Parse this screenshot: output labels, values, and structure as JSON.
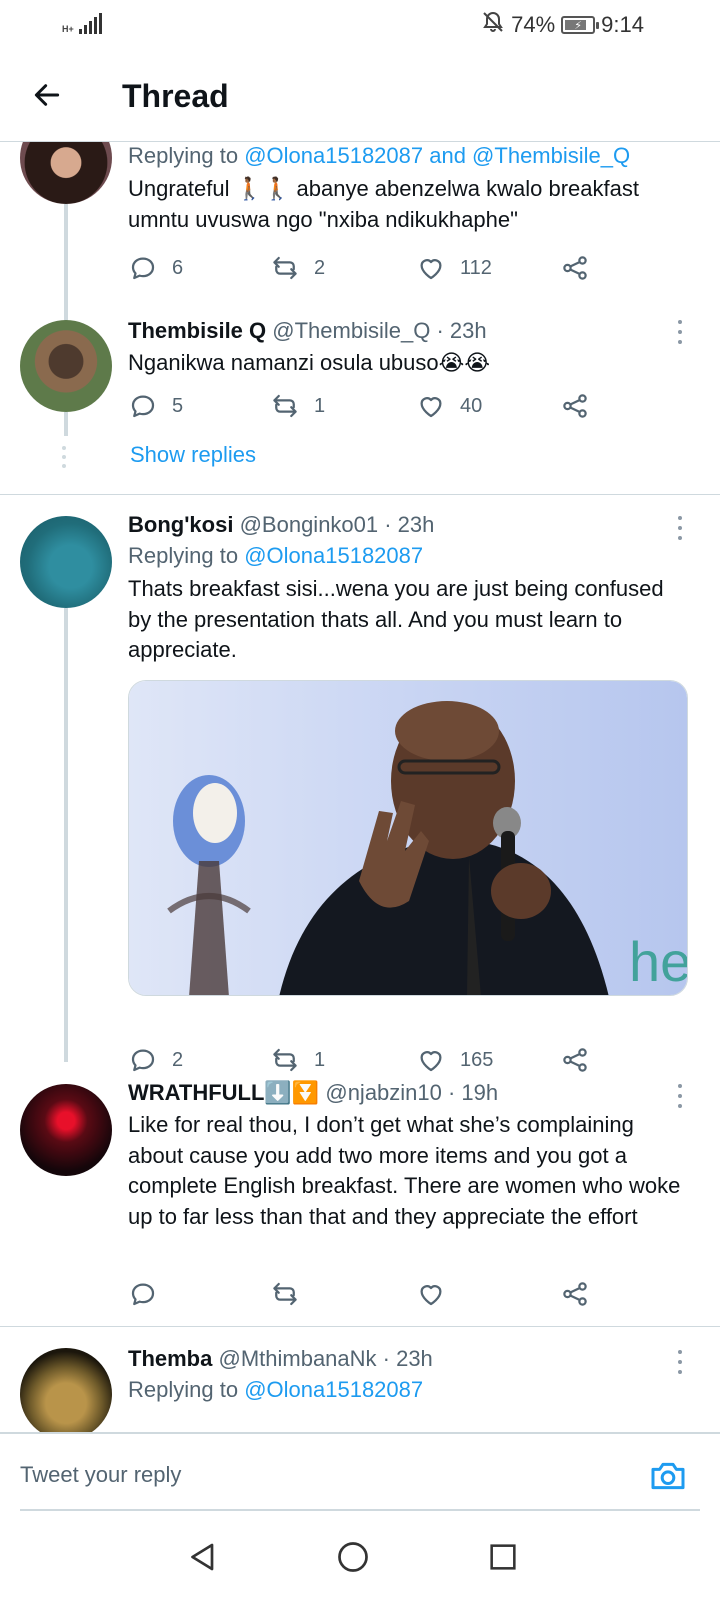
{
  "status_bar": {
    "network": "H+",
    "battery_percent": "74%",
    "time": "9:14"
  },
  "header": {
    "title": "Thread"
  },
  "tweets": [
    {
      "replying_label": "Replying to",
      "replying_to": "@Olona15182087 and @Thembisile_Q",
      "text": "Ungrateful 🚶🏾🚶🏾 abanye abenzelwa kwalo breakfast umntu uvuswa ngo \"nxiba ndikukhaphe\"",
      "replies": "6",
      "retweets": "2",
      "likes": "112"
    },
    {
      "name": "Thembisile Q",
      "handle": "@Thembisile_Q · 23h",
      "text": "Nganikwa namanzi osula ubuso😭😭",
      "replies": "5",
      "retweets": "1",
      "likes": "40",
      "show_replies": "Show replies"
    },
    {
      "name": "Bong'kosi",
      "handle": "@Bonginko01 · 23h",
      "replying_label": "Replying to",
      "replying_to": "@Olona15182087",
      "text": "Thats breakfast sisi...wena you are just being confused by the presentation thats all. And you must learn to appreciate.",
      "replies": "2",
      "retweets": "1",
      "likes": "165"
    },
    {
      "name": "WRATHFULL⬇️⏬",
      "handle": "@njabzin10 · 19h",
      "text": "Like for real thou, I don’t get what she’s complaining about cause you add two more items and you got a complete English breakfast. There are women who woke up to far less than that and they appreciate the effort",
      "replies": "",
      "retweets": "",
      "likes": ""
    },
    {
      "name": "Themba",
      "handle": "@MthimbanaNk · 23h",
      "replying_label": "Replying to",
      "replying_to": "@Olona15182087"
    }
  ],
  "reply_bar": {
    "placeholder": "Tweet your reply"
  },
  "colors": {
    "accent": "#1d9bf0",
    "text": "#0f1419",
    "secondary": "#536471",
    "divider": "#cfd9de"
  }
}
